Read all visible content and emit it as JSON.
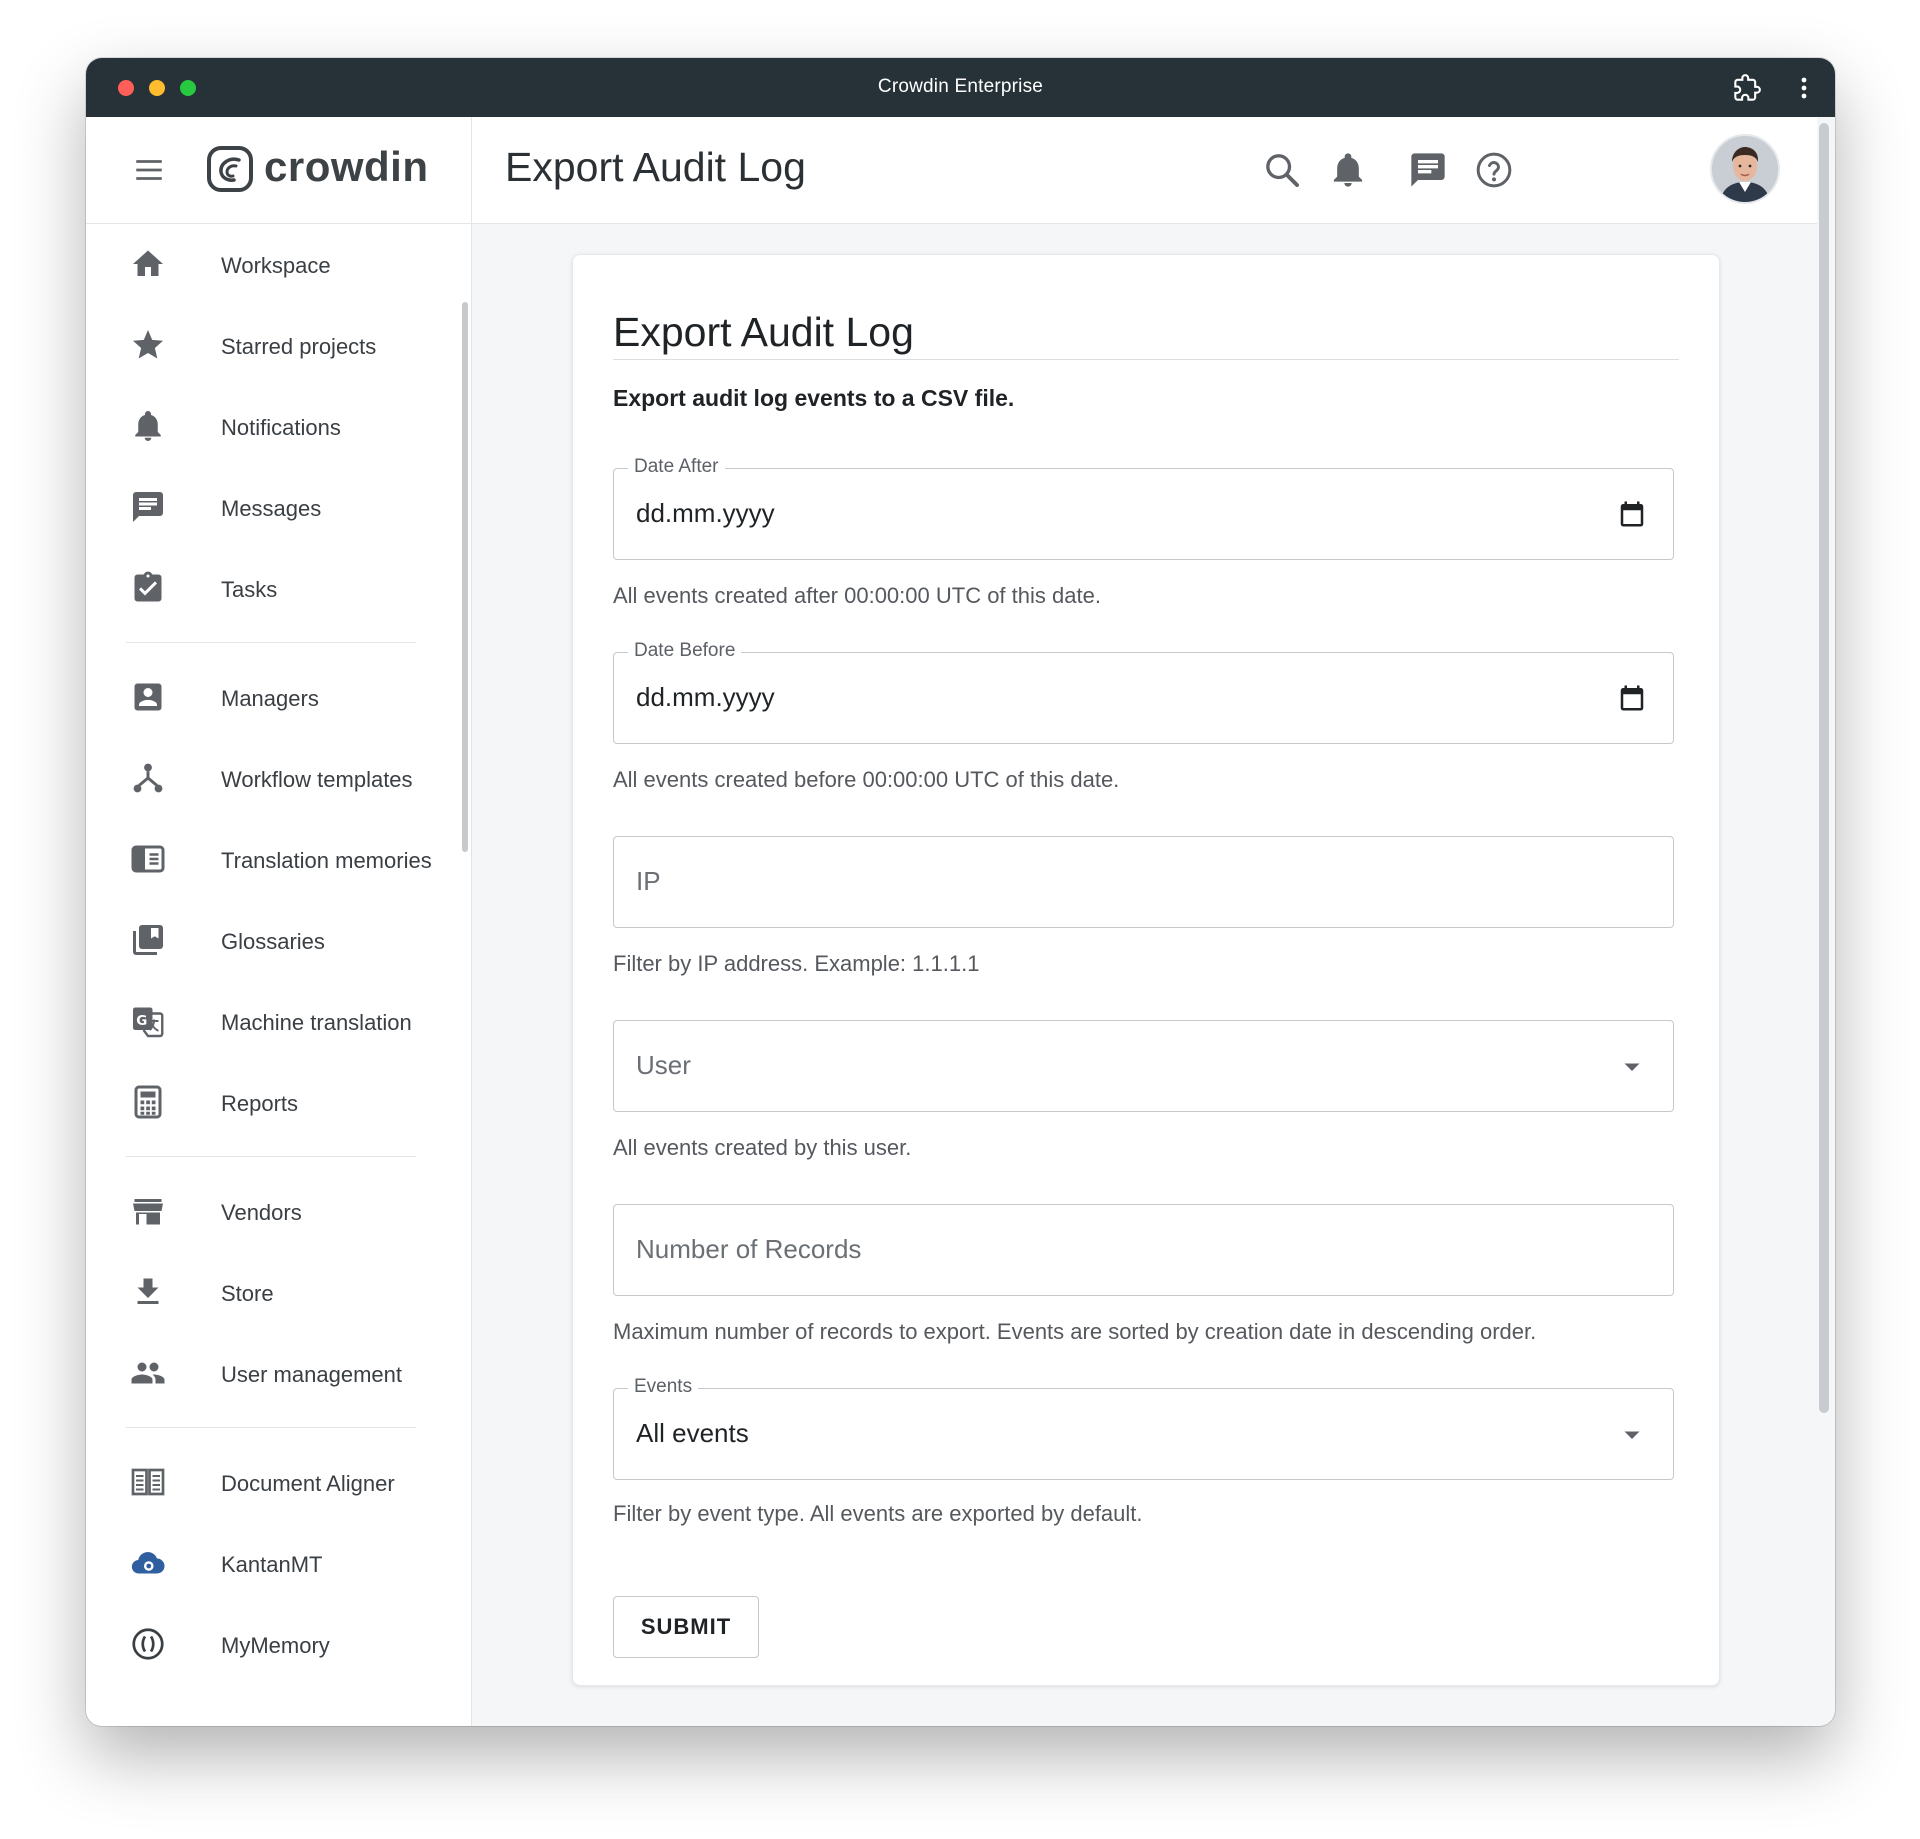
{
  "window": {
    "title": "Crowdin Enterprise"
  },
  "sidebar": {
    "logo_text": "crowdin",
    "groups": [
      [
        {
          "label": "Workspace",
          "icon": "home-icon",
          "name": "sidebar-item-workspace"
        },
        {
          "label": "Starred projects",
          "icon": "star-icon",
          "name": "sidebar-item-starred-projects"
        },
        {
          "label": "Notifications",
          "icon": "bell-icon",
          "name": "sidebar-item-notifications"
        },
        {
          "label": "Messages",
          "icon": "message-icon",
          "name": "sidebar-item-messages"
        },
        {
          "label": "Tasks",
          "icon": "clipboard-check-icon",
          "name": "sidebar-item-tasks"
        }
      ],
      [
        {
          "label": "Managers",
          "icon": "contact-card-icon",
          "name": "sidebar-item-managers"
        },
        {
          "label": "Workflow templates",
          "icon": "workflow-icon",
          "name": "sidebar-item-workflow-templates"
        },
        {
          "label": "Translation memories",
          "icon": "translation-memory-icon",
          "name": "sidebar-item-translation-memories"
        },
        {
          "label": "Glossaries",
          "icon": "library-books-icon",
          "name": "sidebar-item-glossaries"
        },
        {
          "label": "Machine translation",
          "icon": "google-translate-icon",
          "name": "sidebar-item-machine-translation"
        },
        {
          "label": "Reports",
          "icon": "calculator-icon",
          "name": "sidebar-item-reports"
        }
      ],
      [
        {
          "label": "Vendors",
          "icon": "storefront-icon",
          "name": "sidebar-item-vendors"
        },
        {
          "label": "Store",
          "icon": "download-icon",
          "name": "sidebar-item-store"
        },
        {
          "label": "User management",
          "icon": "people-icon",
          "name": "sidebar-item-user-management"
        }
      ],
      [
        {
          "label": "Document Aligner",
          "icon": "document-aligner-icon",
          "name": "sidebar-item-document-aligner"
        },
        {
          "label": "KantanMT",
          "icon": "kantanmt-cloud-icon",
          "name": "sidebar-item-kantanmt"
        },
        {
          "label": "MyMemory",
          "icon": "mymemory-icon",
          "name": "sidebar-item-mymemory"
        }
      ]
    ]
  },
  "header": {
    "title": "Export Audit Log"
  },
  "form": {
    "title": "Export Audit Log",
    "description": "Export audit log events to a CSV file.",
    "date_after": {
      "label": "Date After",
      "value": "dd.mm.yyyy",
      "help": "All events created after 00:00:00 UTC of this date."
    },
    "date_before": {
      "label": "Date Before",
      "value": "dd.mm.yyyy",
      "help": "All events created before 00:00:00 UTC of this date."
    },
    "ip": {
      "placeholder": "IP",
      "help": "Filter by IP address. Example: 1.1.1.1"
    },
    "user": {
      "placeholder": "User",
      "help": "All events created by this user."
    },
    "records": {
      "placeholder": "Number of Records",
      "help": "Maximum number of records to export. Events are sorted by creation date in descending order."
    },
    "events": {
      "label": "Events",
      "value": "All events",
      "help": "Filter by event type. All events are exported by default."
    },
    "submit_label": "SUBMIT"
  },
  "colors": {
    "titlebar": "#263238",
    "icon_gray": "#5f6368",
    "kantan_blue": "#2f5f9e"
  }
}
